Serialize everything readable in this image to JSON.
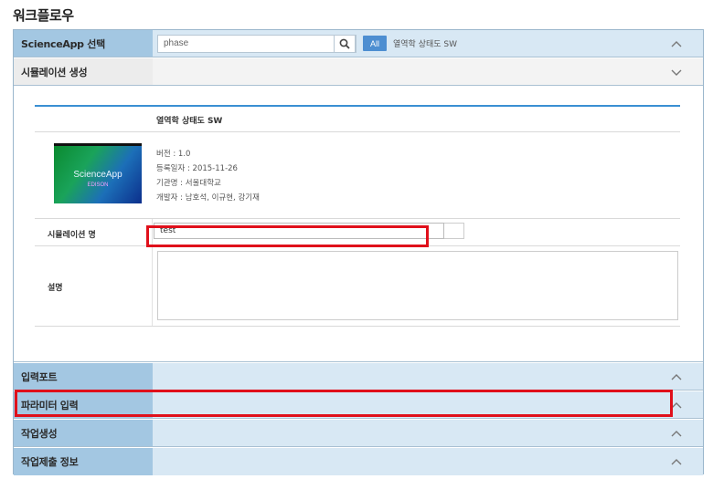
{
  "page_title": "워크플로우",
  "rows": {
    "scienceapp": {
      "label": "ScienceApp 선택"
    },
    "simulation": {
      "label": "시뮬레이션 생성"
    },
    "input_port": {
      "label": "입력포트"
    },
    "parameter": {
      "label": "파라미터 입력"
    },
    "job_create": {
      "label": "작업생성"
    },
    "job_submit": {
      "label": "작업제출 정보"
    }
  },
  "search": {
    "value": "phase",
    "all_label": "All",
    "selected_app": "열역학 상태도 SW"
  },
  "app": {
    "name": "열역학 상태도 SW",
    "thumb_title": "ScienceApp",
    "thumb_sub": "EDISON",
    "version": "버전 : 1.0",
    "registered": "등록일자 : 2015-11-26",
    "organization": "기관명 : 서울대학교",
    "developers": "개발자 : 남호석, 이규현, 강기재"
  },
  "form": {
    "sim_name_label": "시뮬레이션 명",
    "sim_name_value": "test",
    "description_label": "설명"
  },
  "colors": {
    "accent": "#3a8fd3",
    "highlight": "#e0101b",
    "header_blue": "#a3c7e2"
  }
}
